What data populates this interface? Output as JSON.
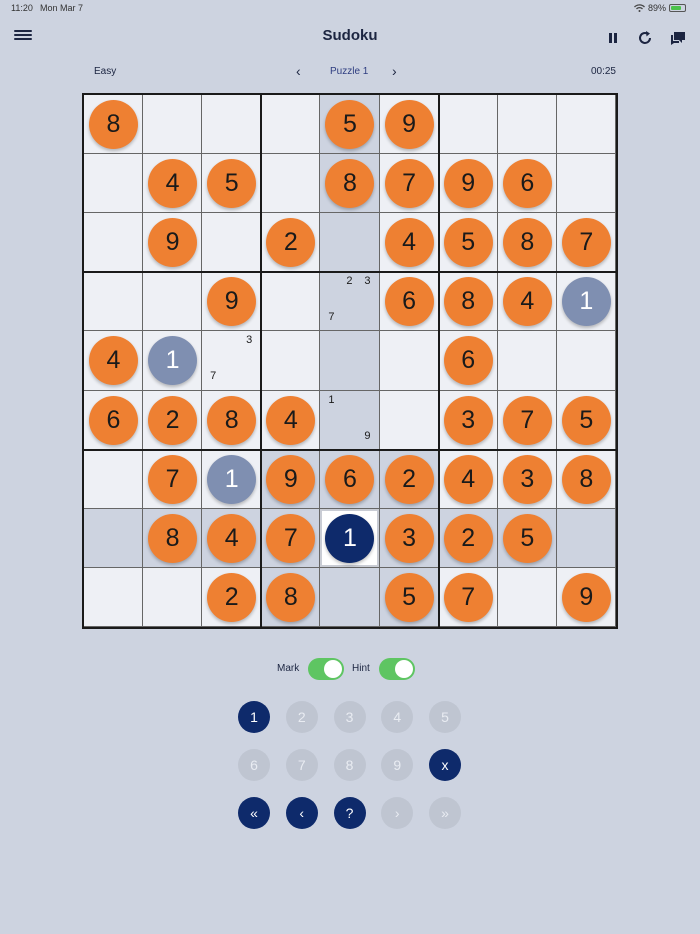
{
  "status_bar": {
    "time": "11:20",
    "date": "Mon Mar 7",
    "battery": "89%"
  },
  "app": {
    "title": "Sudoku"
  },
  "toolbar": {
    "menu_icon": "menu-icon",
    "pause_icon": "pause-icon",
    "refresh_icon": "refresh-icon",
    "chat_icon": "chat-icon"
  },
  "game_info": {
    "difficulty": "Easy",
    "puzzle_label": "Puzzle 1",
    "prev_icon": "‹",
    "next_icon": "›",
    "timer": "00:25"
  },
  "board": {
    "cells": [
      [
        "8",
        "",
        "",
        "",
        "5",
        "9",
        "",
        "",
        ""
      ],
      [
        "",
        "4",
        "5",
        "",
        "8",
        "7",
        "9",
        "6",
        ""
      ],
      [
        "",
        "9",
        "",
        "2",
        "",
        "4",
        "5",
        "8",
        "7"
      ],
      [
        "",
        "",
        "9",
        "",
        "",
        "6",
        "8",
        "4",
        "1"
      ],
      [
        "4",
        "1",
        "",
        "",
        "",
        "",
        "6",
        "",
        ""
      ],
      [
        "6",
        "2",
        "8",
        "4",
        "",
        "",
        "3",
        "7",
        "5"
      ],
      [
        "",
        "7",
        "1",
        "9",
        "6",
        "2",
        "4",
        "3",
        "8"
      ],
      [
        "",
        "8",
        "4",
        "7",
        "1",
        "3",
        "2",
        "5",
        ""
      ],
      [
        "",
        "",
        "2",
        "8",
        "",
        "5",
        "7",
        "",
        "9"
      ]
    ],
    "kinds": [
      [
        "g",
        "",
        "",
        "",
        "g",
        "g",
        "",
        "",
        ""
      ],
      [
        "",
        "g",
        "g",
        "",
        "g",
        "g",
        "g",
        "g",
        ""
      ],
      [
        "",
        "g",
        "",
        "g",
        "",
        "g",
        "g",
        "g",
        "g"
      ],
      [
        "",
        "",
        "g",
        "",
        "",
        "g",
        "g",
        "g",
        "e"
      ],
      [
        "g",
        "e",
        "",
        "",
        "",
        "",
        "g",
        "",
        ""
      ],
      [
        "g",
        "g",
        "g",
        "g",
        "",
        "",
        "g",
        "g",
        "g"
      ],
      [
        "",
        "g",
        "e",
        "g",
        "g",
        "g",
        "g",
        "g",
        "g"
      ],
      [
        "",
        "g",
        "g",
        "g",
        "s",
        "g",
        "g",
        "g",
        ""
      ],
      [
        "",
        "",
        "g",
        "g",
        "",
        "g",
        "g",
        "",
        "g"
      ]
    ],
    "notes": [
      {
        "row": 3,
        "col": 4,
        "values": [
          "2",
          "3",
          "7"
        ]
      },
      {
        "row": 4,
        "col": 2,
        "values": [
          "3",
          "7"
        ]
      },
      {
        "row": 5,
        "col": 4,
        "values": [
          "1",
          "9"
        ]
      }
    ],
    "selected": {
      "row": 7,
      "col": 4
    },
    "colors": {
      "given": "#ee8032",
      "entered": "#7f8fb1",
      "selected": "#0e2a6b"
    }
  },
  "toggles": {
    "mark_label": "Mark",
    "mark_on": true,
    "hint_label": "Hint",
    "hint_on": true
  },
  "keypad": [
    {
      "label": "1",
      "style": "dark"
    },
    {
      "label": "2",
      "style": "light"
    },
    {
      "label": "3",
      "style": "light"
    },
    {
      "label": "4",
      "style": "light"
    },
    {
      "label": "5",
      "style": "light"
    },
    {
      "label": "6",
      "style": "light"
    },
    {
      "label": "7",
      "style": "light"
    },
    {
      "label": "8",
      "style": "light"
    },
    {
      "label": "9",
      "style": "light"
    },
    {
      "label": "x",
      "style": "dark"
    },
    {
      "label": "«",
      "style": "dark"
    },
    {
      "label": "‹",
      "style": "dark"
    },
    {
      "label": "?",
      "style": "dark"
    },
    {
      "label": "›",
      "style": "light"
    },
    {
      "label": "»",
      "style": "light"
    }
  ]
}
